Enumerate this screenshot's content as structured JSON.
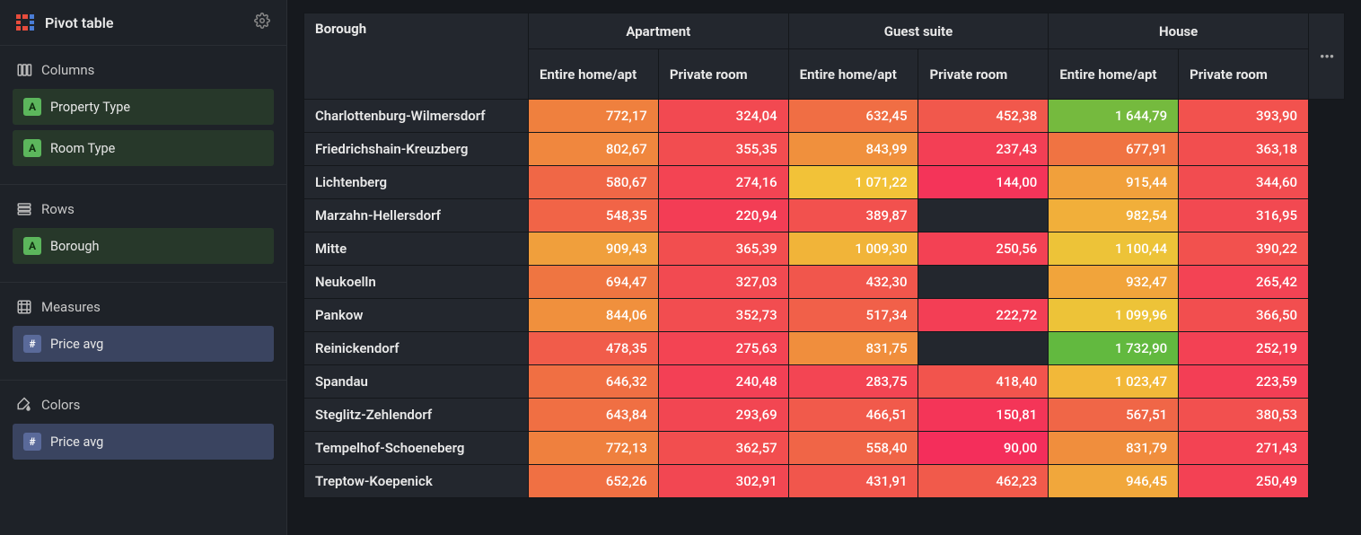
{
  "header": {
    "title": "Pivot table"
  },
  "sidebar": {
    "columns": {
      "label": "Columns",
      "items": [
        "Property Type",
        "Room Type"
      ]
    },
    "rows": {
      "label": "Rows",
      "items": [
        "Borough"
      ]
    },
    "measures": {
      "label": "Measures",
      "items": [
        "Price avg"
      ]
    },
    "colors": {
      "label": "Colors",
      "items": [
        "Price avg"
      ]
    }
  },
  "table": {
    "corner": "Borough",
    "top_groups": [
      "Apartment",
      "Guest suite",
      "House"
    ],
    "sub_columns": [
      "Entire home/apt",
      "Private room"
    ],
    "rows": [
      {
        "label": "Charlottenburg-Wilmersdorf",
        "values": [
          "772,17",
          "324,04",
          "632,45",
          "452,38",
          "1 644,79",
          "393,90"
        ]
      },
      {
        "label": "Friedrichshain-Kreuzberg",
        "values": [
          "802,67",
          "355,35",
          "843,99",
          "237,43",
          "677,91",
          "363,18"
        ]
      },
      {
        "label": "Lichtenberg",
        "values": [
          "580,67",
          "274,16",
          "1 071,22",
          "144,00",
          "915,44",
          "344,60"
        ]
      },
      {
        "label": "Marzahn-Hellersdorf",
        "values": [
          "548,35",
          "220,94",
          "389,87",
          "",
          "982,54",
          "316,95"
        ]
      },
      {
        "label": "Mitte",
        "values": [
          "909,43",
          "365,39",
          "1 009,30",
          "250,56",
          "1 100,44",
          "390,22"
        ]
      },
      {
        "label": "Neukoelln",
        "values": [
          "694,47",
          "327,03",
          "432,30",
          "",
          "932,47",
          "265,42"
        ]
      },
      {
        "label": "Pankow",
        "values": [
          "844,06",
          "352,73",
          "517,34",
          "222,72",
          "1 099,96",
          "366,50"
        ]
      },
      {
        "label": "Reinickendorf",
        "values": [
          "478,35",
          "275,63",
          "831,75",
          "",
          "1 732,90",
          "252,19"
        ]
      },
      {
        "label": "Spandau",
        "values": [
          "646,32",
          "240,48",
          "283,75",
          "418,40",
          "1 023,47",
          "223,59"
        ]
      },
      {
        "label": "Steglitz-Zehlendorf",
        "values": [
          "643,84",
          "293,69",
          "466,51",
          "150,81",
          "567,51",
          "380,53"
        ]
      },
      {
        "label": "Tempelhof-Schoeneberg",
        "values": [
          "772,13",
          "362,57",
          "558,40",
          "90,00",
          "831,79",
          "271,43"
        ]
      },
      {
        "label": "Treptow-Koepenick",
        "values": [
          "652,26",
          "302,91",
          "431,91",
          "462,23",
          "946,45",
          "250,49"
        ]
      }
    ]
  },
  "chart_data": {
    "type": "heatmap",
    "title": "Price avg by Borough × Property Type × Room Type",
    "row_label": "Borough",
    "column_groups": [
      "Apartment",
      "Guest suite",
      "House"
    ],
    "sub_columns": [
      "Entire home/apt",
      "Private room"
    ],
    "rows": [
      "Charlottenburg-Wilmersdorf",
      "Friedrichshain-Kreuzberg",
      "Lichtenberg",
      "Marzahn-Hellersdorf",
      "Mitte",
      "Neukoelln",
      "Pankow",
      "Reinickendorf",
      "Spandau",
      "Steglitz-Zehlendorf",
      "Tempelhof-Schoeneberg",
      "Treptow-Koepenick"
    ],
    "values": [
      [
        772.17,
        324.04,
        632.45,
        452.38,
        1644.79,
        393.9
      ],
      [
        802.67,
        355.35,
        843.99,
        237.43,
        677.91,
        363.18
      ],
      [
        580.67,
        274.16,
        1071.22,
        144.0,
        915.44,
        344.6
      ],
      [
        548.35,
        220.94,
        389.87,
        null,
        982.54,
        316.95
      ],
      [
        909.43,
        365.39,
        1009.3,
        250.56,
        1100.44,
        390.22
      ],
      [
        694.47,
        327.03,
        432.3,
        null,
        932.47,
        265.42
      ],
      [
        844.06,
        352.73,
        517.34,
        222.72,
        1099.96,
        366.5
      ],
      [
        478.35,
        275.63,
        831.75,
        null,
        1732.9,
        252.19
      ],
      [
        646.32,
        240.48,
        283.75,
        418.4,
        1023.47,
        223.59
      ],
      [
        643.84,
        293.69,
        466.51,
        150.81,
        567.51,
        380.53
      ],
      [
        772.13,
        362.57,
        558.4,
        90.0,
        831.79,
        271.43
      ],
      [
        652.26,
        302.91,
        431.91,
        462.23,
        946.45,
        250.49
      ]
    ],
    "color_scale": {
      "low": "#f42e5b",
      "mid": "#f2c338",
      "high": "#62b93f",
      "range": [
        90,
        1733
      ]
    }
  }
}
